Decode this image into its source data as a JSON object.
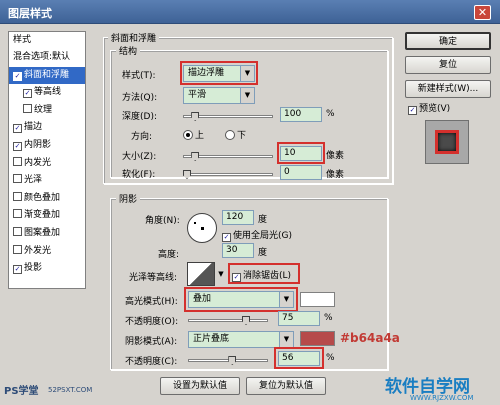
{
  "window": {
    "title": "图层样式",
    "close_glyph": "✕"
  },
  "sidebar": {
    "header": "样式",
    "items": [
      {
        "label": "混合选项:默认",
        "checkbox": false,
        "checked": false,
        "selected": false
      },
      {
        "label": "斜面和浮雕",
        "checkbox": true,
        "checked": true,
        "selected": true
      },
      {
        "label": "等高线",
        "checkbox": true,
        "checked": true,
        "selected": false
      },
      {
        "label": "纹理",
        "checkbox": true,
        "checked": false,
        "selected": false
      },
      {
        "label": "描边",
        "checkbox": true,
        "checked": true,
        "selected": false
      },
      {
        "label": "内阴影",
        "checkbox": true,
        "checked": true,
        "selected": false
      },
      {
        "label": "内发光",
        "checkbox": true,
        "checked": false,
        "selected": false
      },
      {
        "label": "光泽",
        "checkbox": true,
        "checked": false,
        "selected": false
      },
      {
        "label": "颜色叠加",
        "checkbox": true,
        "checked": false,
        "selected": false
      },
      {
        "label": "渐变叠加",
        "checkbox": true,
        "checked": false,
        "selected": false
      },
      {
        "label": "图案叠加",
        "checkbox": true,
        "checked": false,
        "selected": false
      },
      {
        "label": "外发光",
        "checkbox": true,
        "checked": false,
        "selected": false
      },
      {
        "label": "投影",
        "checkbox": true,
        "checked": true,
        "selected": false
      }
    ],
    "check_glyph": "✓"
  },
  "bevel": {
    "title": "斜面和浮雕",
    "structure_title": "结构",
    "style_label": "样式(T):",
    "style_value": "描边浮雕",
    "method_label": "方法(Q):",
    "method_value": "平滑",
    "depth_label": "深度(D):",
    "depth_value": "100",
    "depth_unit": "%",
    "direction_label": "方向:",
    "dir_up": "上",
    "dir_down": "下",
    "direction_selected": "上",
    "size_label": "大小(Z):",
    "size_value": "10",
    "size_unit": "像素",
    "soften_label": "软化(F):",
    "soften_value": "0",
    "soften_unit": "像素",
    "depth_slider": 0.1,
    "size_slider": 0.1,
    "soften_slider": 0.0
  },
  "shading": {
    "title": "阴影",
    "angle_label": "角度(N):",
    "angle_value": "120",
    "angle_unit": "度",
    "global_light_label": "使用全局光(G)",
    "global_light_checked": true,
    "altitude_label": "高度:",
    "altitude_value": "30",
    "altitude_unit": "度",
    "gloss_label": "光泽等高线:",
    "anti_alias_label": "消除锯齿(L)",
    "anti_alias_checked": true,
    "highlight_label": "高光模式(H):",
    "highlight_value": "叠加",
    "highlight_color": "#ffffff",
    "highlight_opacity_label": "不透明度(O):",
    "highlight_opacity_value": "75",
    "highlight_opacity_unit": "%",
    "shadow_label": "阴影模式(A):",
    "shadow_value": "正片叠底",
    "shadow_color": "#b64a4a",
    "shadow_opacity_label": "不透明度(C):",
    "shadow_opacity_value": "56",
    "shadow_opacity_unit": "%",
    "highlight_slider": 0.75,
    "shadow_slider": 0.56
  },
  "annotation": {
    "color_note": "#b64a4a"
  },
  "buttons": {
    "ok": "确定",
    "reset": "复位",
    "new_style": "新建样式(W)...",
    "preview_label": "预览(V)",
    "preview_checked": true,
    "make_default": "设置为默认值",
    "reset_default": "复位为默认值"
  },
  "watermark": {
    "left": "PS学堂",
    "left_url": "52PSXT.COM",
    "right": "软件自学网",
    "right_url": "WWW.RJZXW.COM"
  },
  "colors": {
    "accent": "#3169c6",
    "redbox": "#d4302d",
    "field": "#d6ecd6"
  }
}
